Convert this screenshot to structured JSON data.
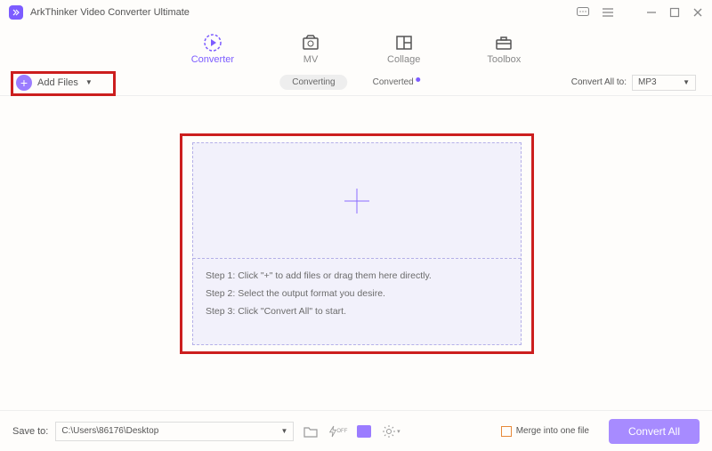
{
  "app": {
    "title": "ArkThinker Video Converter Ultimate"
  },
  "tabs": [
    {
      "label": "Converter",
      "active": true
    },
    {
      "label": "MV",
      "active": false
    },
    {
      "label": "Collage",
      "active": false
    },
    {
      "label": "Toolbox",
      "active": false
    }
  ],
  "toolbar": {
    "add_files_label": "Add Files",
    "status_converting": "Converting",
    "status_converted": "Converted",
    "convert_all_to_label": "Convert All to:",
    "output_format": "MP3"
  },
  "dropzone": {
    "step1": "Step 1: Click \"+\" to add files or drag them here directly.",
    "step2": "Step 2: Select the output format you desire.",
    "step3": "Step 3: Click \"Convert All\" to start."
  },
  "bottombar": {
    "save_to_label": "Save to:",
    "save_path": "C:\\Users\\86176\\Desktop",
    "merge_label": "Merge into one file",
    "convert_all_label": "Convert All"
  }
}
